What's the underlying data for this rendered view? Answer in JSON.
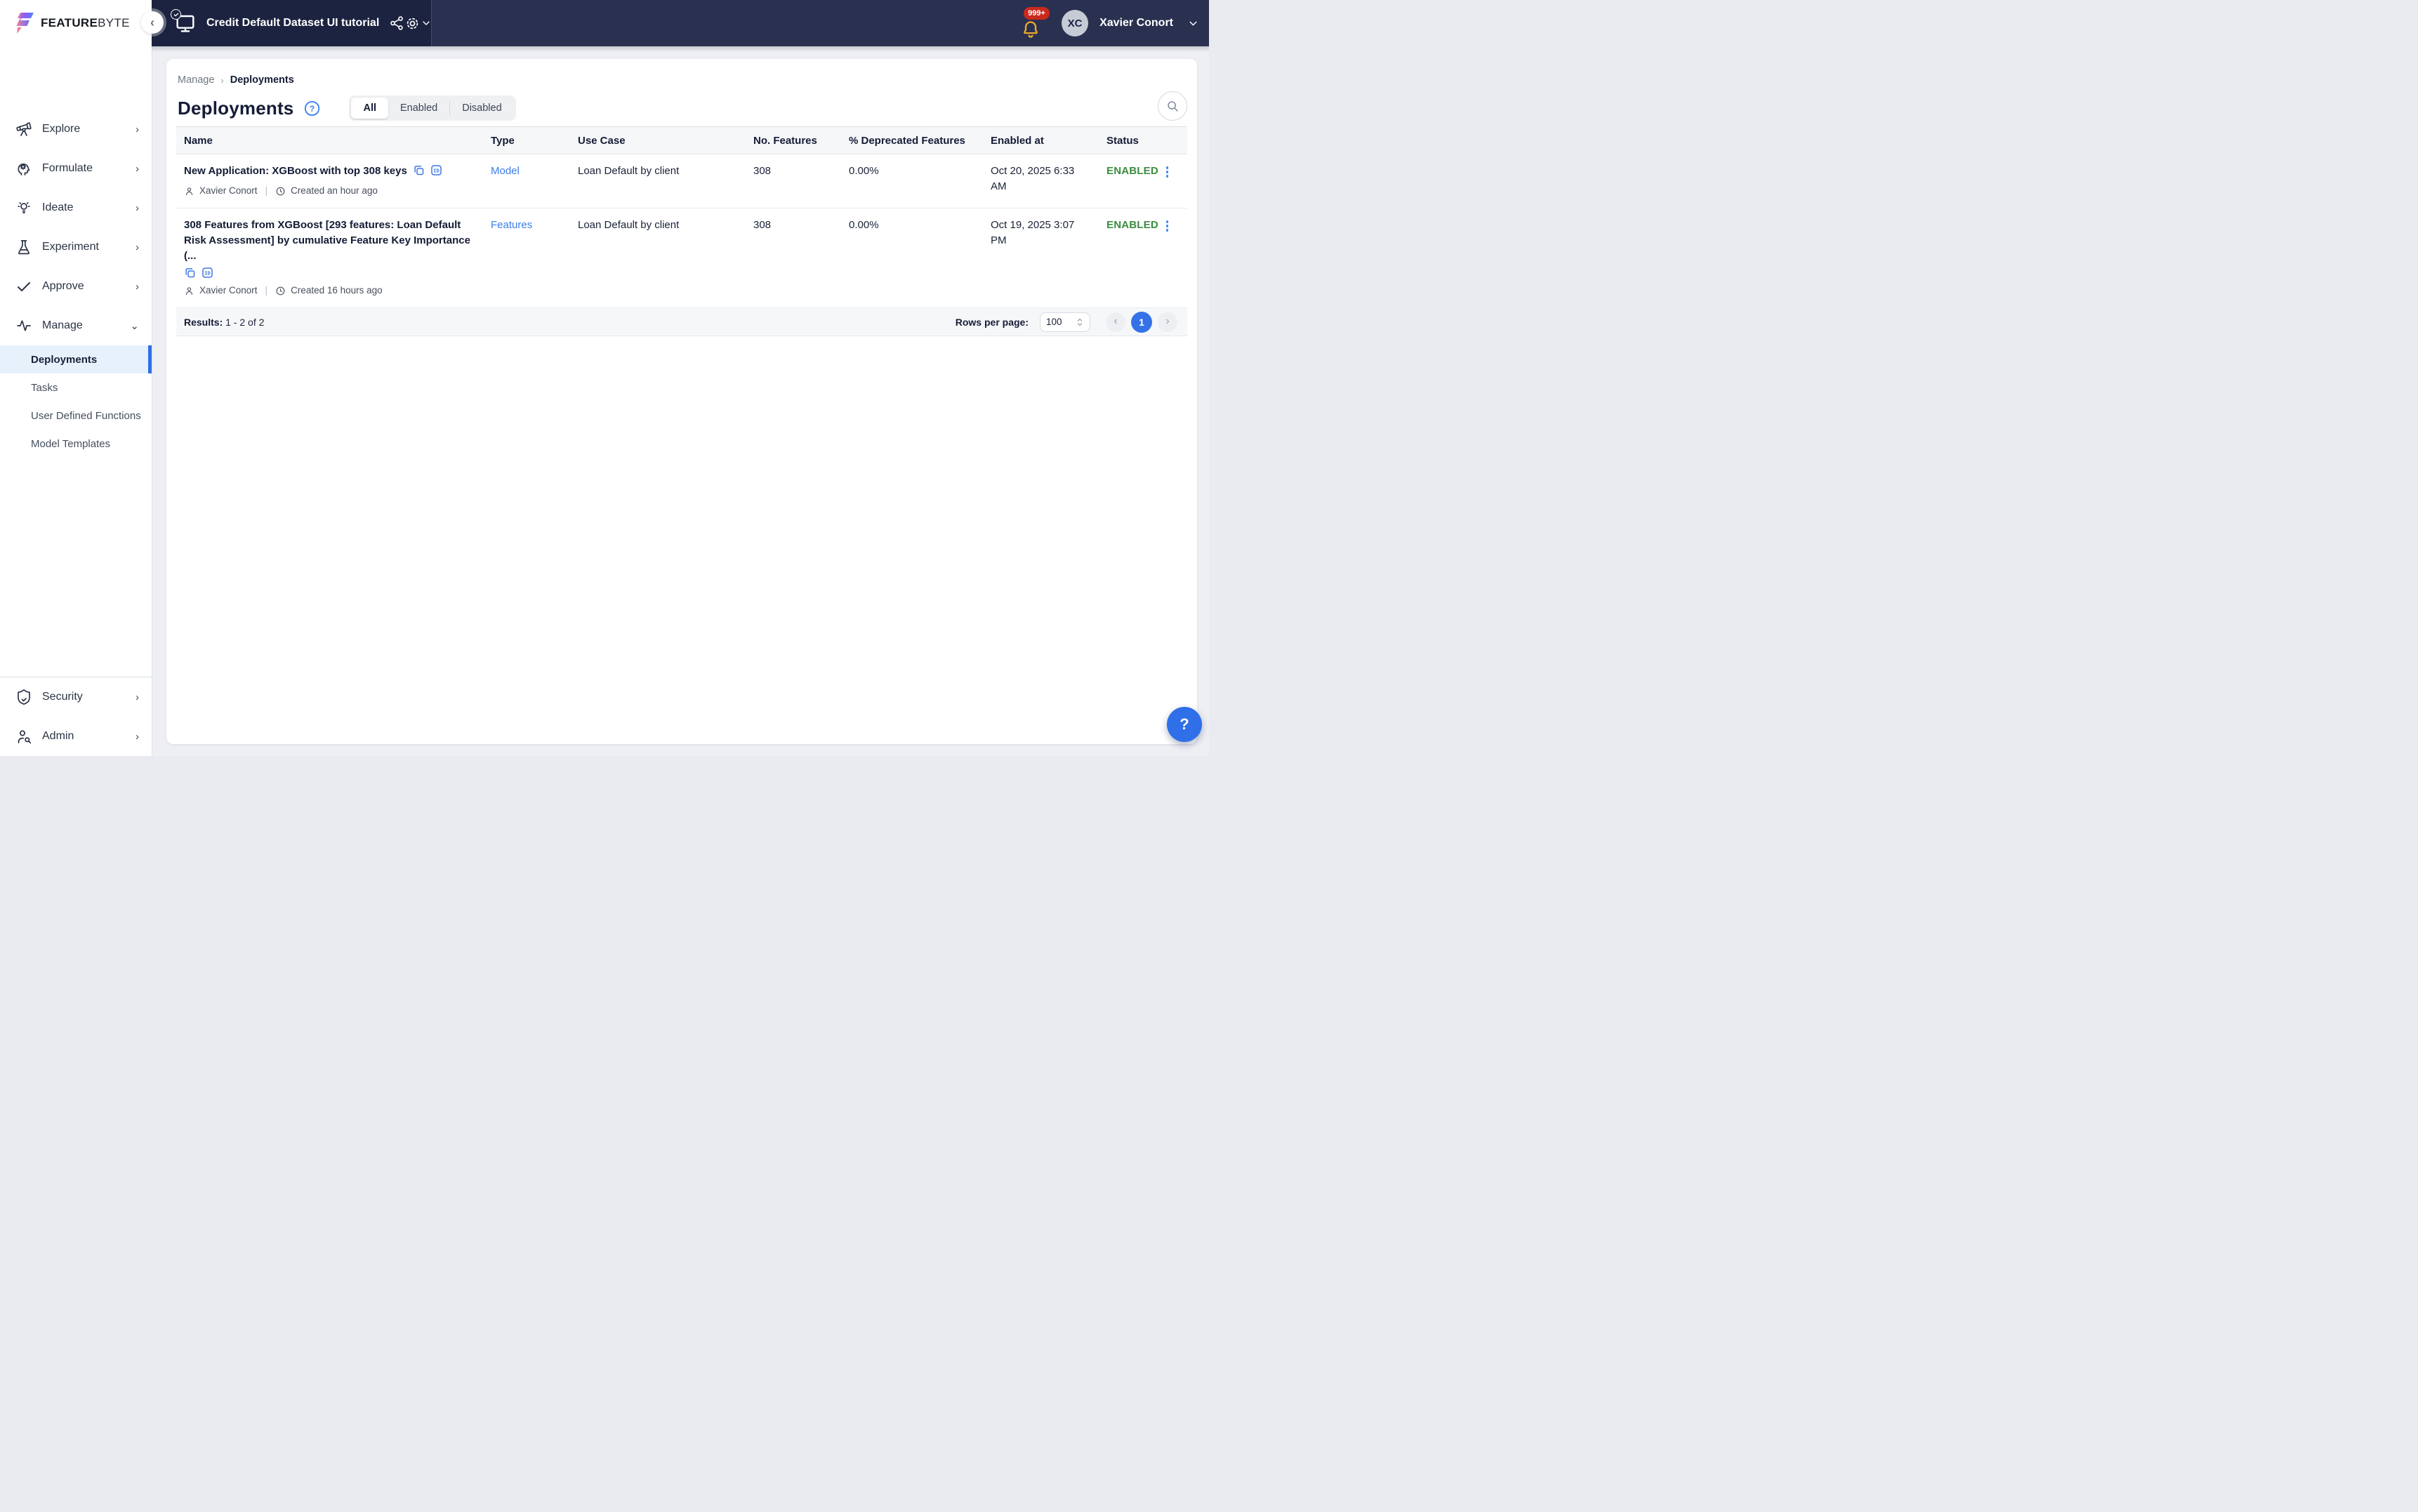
{
  "brand": {
    "name_primary": "FEATURE",
    "name_secondary": "BYTE"
  },
  "topbar": {
    "project_title": "Credit Default Dataset UI tutorial",
    "notification_count": "999+",
    "user_initials": "XC",
    "user_name": "Xavier Conort",
    "collapse_glyph": "‹"
  },
  "sidebar": {
    "items": [
      {
        "label": "Explore",
        "chevron": "›"
      },
      {
        "label": "Formulate",
        "chevron": "›"
      },
      {
        "label": "Ideate",
        "chevron": "›"
      },
      {
        "label": "Experiment",
        "chevron": "›"
      },
      {
        "label": "Approve",
        "chevron": "›"
      },
      {
        "label": "Manage",
        "chevron": "⌄"
      }
    ],
    "manage_children": [
      {
        "label": "Deployments",
        "active": true
      },
      {
        "label": "Tasks"
      },
      {
        "label": "User Defined Functions"
      },
      {
        "label": "Model Templates"
      }
    ],
    "bottom_items": [
      {
        "label": "Security",
        "chevron": "›"
      },
      {
        "label": "Admin",
        "chevron": "›"
      }
    ]
  },
  "breadcrumb": {
    "parent": "Manage",
    "separator": "›",
    "current": "Deployments"
  },
  "page": {
    "title": "Deployments"
  },
  "tabs": [
    {
      "label": "All"
    },
    {
      "label": "Enabled"
    },
    {
      "label": "Disabled"
    }
  ],
  "icons": {
    "id_badge": "ID",
    "help_glyph": "?"
  },
  "meta_separator": "|",
  "table": {
    "columns": [
      "Name",
      "Type",
      "Use Case",
      "No. Features",
      "% Deprecated Features",
      "Enabled at",
      "Status"
    ],
    "rows": [
      {
        "name": "New Application: XGBoost with top 308 keys",
        "owner": "Xavier Conort",
        "created": "Created an hour ago",
        "type": "Model",
        "use_case": "Loan Default by client",
        "no_features": "308",
        "pct_deprecated": "0.00%",
        "enabled_at": "Oct 20, 2025 6:33\nAM",
        "status": "ENABLED"
      },
      {
        "name": "308 Features from XGBoost [293 features: Loan Default Risk Assessment] by cumulative Feature Key Importance (...",
        "owner": "Xavier Conort",
        "created": "Created 16 hours ago",
        "type": "Features",
        "use_case": "Loan Default by client",
        "no_features": "308",
        "pct_deprecated": "0.00%",
        "enabled_at": "Oct 19, 2025 3:07 PM",
        "status": "ENABLED"
      }
    ]
  },
  "footer": {
    "results_label": "Results:",
    "results_value": "1 - 2 of 2",
    "rows_per_page_label": "Rows per page:",
    "rows_per_page_value": "100",
    "prev_glyph": "‹",
    "current_page": "1",
    "next_glyph": "›"
  },
  "colors": {
    "accent_blue": "#2f6fe8",
    "status_green": "#3c8c40",
    "badge_red": "#c92a1d",
    "topbar_navy": "#2a3150"
  }
}
